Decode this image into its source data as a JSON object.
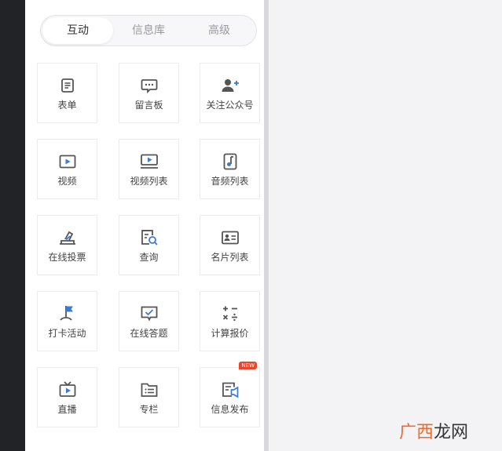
{
  "tabs": [
    {
      "label": "互动",
      "active": true
    },
    {
      "label": "信息库",
      "active": false
    },
    {
      "label": "高级",
      "active": false
    }
  ],
  "components": [
    {
      "label": "表单",
      "icon": "form-icon"
    },
    {
      "label": "留言板",
      "icon": "message-board-icon"
    },
    {
      "label": "关注公众号",
      "icon": "follow-user-icon"
    },
    {
      "label": "视频",
      "icon": "video-icon"
    },
    {
      "label": "视频列表",
      "icon": "video-list-icon"
    },
    {
      "label": "音频列表",
      "icon": "audio-list-icon"
    },
    {
      "label": "在线投票",
      "icon": "vote-icon"
    },
    {
      "label": "查询",
      "icon": "query-icon"
    },
    {
      "label": "名片列表",
      "icon": "card-list-icon"
    },
    {
      "label": "打卡活动",
      "icon": "checkin-flag-icon"
    },
    {
      "label": "在线答题",
      "icon": "quiz-icon"
    },
    {
      "label": "计算报价",
      "icon": "calculator-icon"
    },
    {
      "label": "直播",
      "icon": "live-tv-icon"
    },
    {
      "label": "专栏",
      "icon": "column-folder-icon"
    },
    {
      "label": "信息发布",
      "icon": "publish-icon",
      "badge": "NEW"
    }
  ],
  "watermark": {
    "part1": "广西",
    "part2": "龙网"
  },
  "colors": {
    "accent": "#3a7bd5",
    "icon": "#555555",
    "badge": "#e8452a"
  }
}
